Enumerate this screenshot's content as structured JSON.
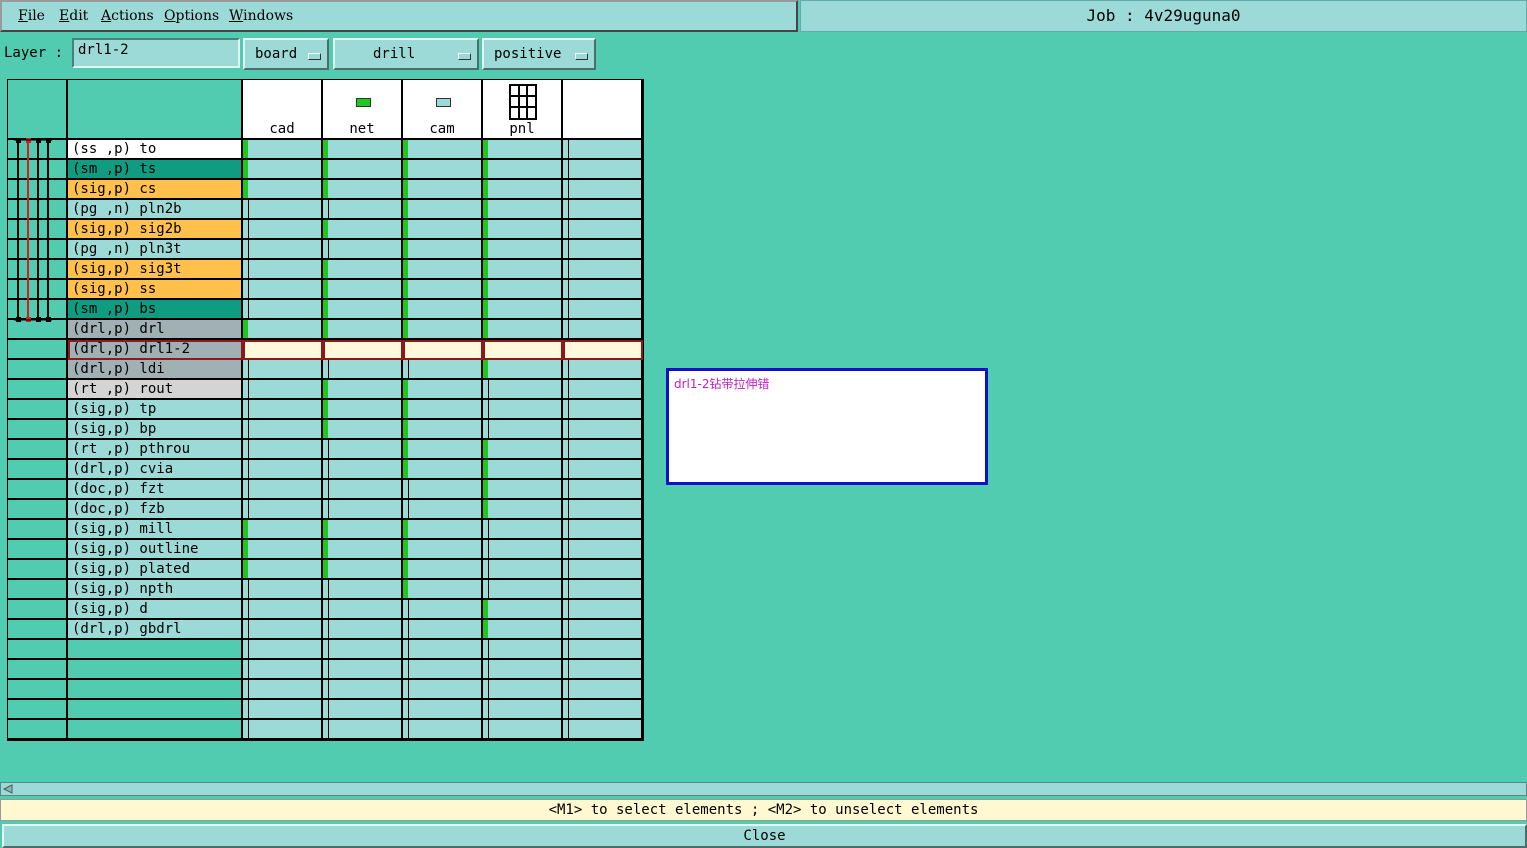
{
  "menu": [
    "File",
    "Edit",
    "Actions",
    "Options",
    "Windows"
  ],
  "job_title": "Job : 4v29uguna0",
  "layer_label": "Layer :",
  "layer_value": "drl1-2",
  "dropdowns": [
    "board",
    "drill",
    "positive"
  ],
  "columns": [
    {
      "label": "cad",
      "icon": "blank"
    },
    {
      "label": "net",
      "icon": "net-icon"
    },
    {
      "label": "cam",
      "icon": "cam-icon"
    },
    {
      "label": "pnl",
      "icon": "panel-grid-icon"
    },
    {
      "label": "",
      "icon": "blank"
    }
  ],
  "layers": [
    {
      "name": "(ss ,p) to",
      "color": "#ffffff",
      "marks": [
        1,
        1,
        1,
        1,
        0
      ]
    },
    {
      "name": "(sm ,p) ts",
      "color": "#109c80",
      "marks": [
        1,
        1,
        1,
        1,
        0
      ]
    },
    {
      "name": "(sig,p) cs",
      "color": "#ffc04c",
      "marks": [
        1,
        1,
        1,
        1,
        0
      ]
    },
    {
      "name": "(pg ,n) pln2b",
      "color": "#9cdad8",
      "marks": [
        0,
        0,
        1,
        1,
        0
      ]
    },
    {
      "name": "(sig,p) sig2b",
      "color": "#ffc04c",
      "marks": [
        0,
        1,
        1,
        1,
        0
      ]
    },
    {
      "name": "(pg ,n) pln3t",
      "color": "#9cdad8",
      "marks": [
        0,
        0,
        1,
        1,
        0
      ]
    },
    {
      "name": "(sig,p) sig3t",
      "color": "#ffc04c",
      "marks": [
        0,
        1,
        1,
        1,
        0
      ]
    },
    {
      "name": "(sig,p) ss",
      "color": "#ffc04c",
      "marks": [
        0,
        1,
        1,
        1,
        0
      ]
    },
    {
      "name": "(sm ,p) bs",
      "color": "#109c80",
      "marks": [
        0,
        1,
        1,
        1,
        0
      ]
    },
    {
      "name": "(drl,p) drl",
      "color": "#a0b0b4",
      "marks": [
        1,
        1,
        1,
        1,
        0
      ]
    },
    {
      "name": "(drl,p) drl1-2",
      "color": "#a0b0b4",
      "marks": [
        0,
        0,
        0,
        0,
        0
      ],
      "selected": true
    },
    {
      "name": "(drl,p) ldi",
      "color": "#a0b0b4",
      "marks": [
        0,
        0,
        0,
        1,
        0
      ]
    },
    {
      "name": "(rt ,p) rout",
      "color": "#d4d4d4",
      "marks": [
        0,
        1,
        1,
        0,
        0
      ]
    },
    {
      "name": "(sig,p) tp",
      "color": "#9cdad8",
      "marks": [
        0,
        1,
        1,
        0,
        0
      ]
    },
    {
      "name": "(sig,p) bp",
      "color": "#9cdad8",
      "marks": [
        0,
        1,
        1,
        0,
        0
      ]
    },
    {
      "name": "(rt ,p) pthrou",
      "color": "#9cdad8",
      "marks": [
        0,
        0,
        1,
        1,
        0
      ]
    },
    {
      "name": "(drl,p) cvia",
      "color": "#9cdad8",
      "marks": [
        0,
        0,
        1,
        1,
        0
      ]
    },
    {
      "name": "(doc,p) fzt",
      "color": "#9cdad8",
      "marks": [
        0,
        0,
        0,
        1,
        0
      ]
    },
    {
      "name": "(doc,p) fzb",
      "color": "#9cdad8",
      "marks": [
        0,
        0,
        0,
        1,
        0
      ]
    },
    {
      "name": "(sig,p) mill",
      "color": "#9cdad8",
      "marks": [
        1,
        1,
        1,
        0,
        0
      ]
    },
    {
      "name": "(sig,p) outline",
      "color": "#9cdad8",
      "marks": [
        1,
        1,
        1,
        0,
        0
      ]
    },
    {
      "name": "(sig,p) plated",
      "color": "#9cdad8",
      "marks": [
        1,
        1,
        1,
        0,
        0
      ]
    },
    {
      "name": "(sig,p) npth",
      "color": "#9cdad8",
      "marks": [
        0,
        0,
        1,
        0,
        0
      ]
    },
    {
      "name": "(sig,p) d",
      "color": "#9cdad8",
      "marks": [
        0,
        0,
        0,
        1,
        0
      ]
    },
    {
      "name": "(drl,p) gbdrl",
      "color": "#9cdad8",
      "marks": [
        0,
        0,
        0,
        1,
        0
      ]
    },
    {
      "name": "",
      "color": "#52ccb0",
      "marks": [
        0,
        0,
        0,
        0,
        0
      ]
    },
    {
      "name": "",
      "color": "#52ccb0",
      "marks": [
        0,
        0,
        0,
        0,
        0
      ]
    },
    {
      "name": "",
      "color": "#52ccb0",
      "marks": [
        0,
        0,
        0,
        0,
        0
      ]
    },
    {
      "name": "",
      "color": "#52ccb0",
      "marks": [
        0,
        0,
        0,
        0,
        0
      ]
    },
    {
      "name": "",
      "color": "#52ccb0",
      "marks": [
        0,
        0,
        0,
        0,
        0
      ]
    }
  ],
  "note_text": "drl1-2钻带拉伸错",
  "status_text": "<M1> to select elements ; <M2> to unselect elements",
  "close_label": "Close"
}
